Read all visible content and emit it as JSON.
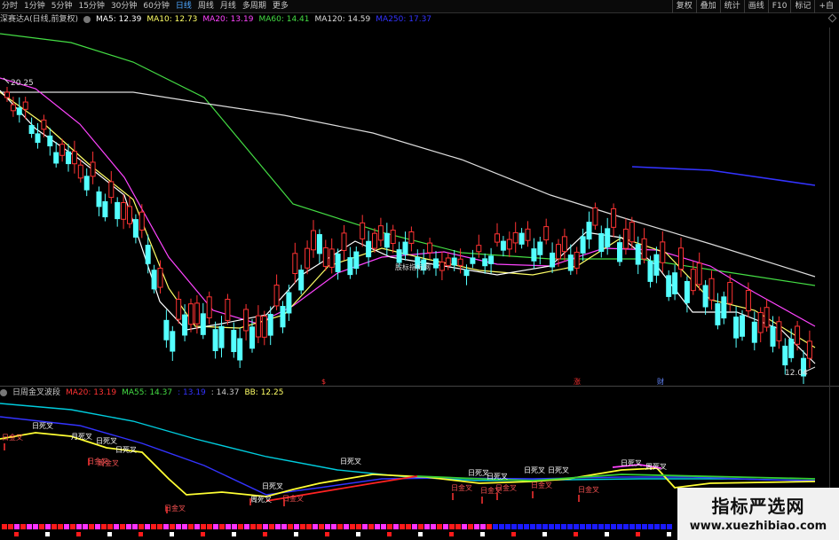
{
  "toolbar": {
    "tabs": [
      "分时",
      "1分钟",
      "5分钟",
      "15分钟",
      "30分钟",
      "60分钟",
      "日线",
      "周线",
      "月线",
      "多周期",
      "更多"
    ],
    "active_tab": 6,
    "tools": [
      "复权",
      "叠加",
      "统计",
      "画线",
      "F10",
      "标记",
      "+自"
    ]
  },
  "main_info": {
    "title": "深赛达A(日线,前复权)",
    "indicators": [
      {
        "text": "MA5: 12.39",
        "color": "#ffffff"
      },
      {
        "text": "MA10: 12.73",
        "color": "#ffff66"
      },
      {
        "text": "MA20: 13.19",
        "color": "#ff44ff"
      },
      {
        "text": "MA60: 14.41",
        "color": "#44dd44"
      },
      {
        "text": "MA120: 14.59",
        "color": "#dddddd"
      },
      {
        "text": "MA250: 17.37",
        "color": "#3333ff"
      }
    ],
    "high_label": "20.25",
    "low_label": "12.04",
    "center_watermark": "股标指标网",
    "event_markers": [
      {
        "text": "$",
        "color": "#ff3333"
      },
      {
        "text": "涨",
        "color": "#ff3333"
      },
      {
        "text": "财",
        "color": "#6688ff"
      }
    ]
  },
  "sub_info": {
    "title": "日周金叉波段",
    "indicators": [
      {
        "text": "MA20: 13.19",
        "color": "#ff3333"
      },
      {
        "text": "MA55: 14.37",
        "color": "#44dd44"
      },
      {
        "text": ": 13.19",
        "color": "#3333ff"
      },
      {
        "text": ": 14.37",
        "color": "#c8c8c8"
      },
      {
        "text": "BB: 12.25",
        "color": "#ffff66"
      }
    ],
    "signal_labels": {
      "day_dead": "日死叉",
      "month_dead": "月死叉",
      "day_gold": "日金叉",
      "week_gold": "周金叉",
      "week_dead": "周死叉"
    }
  },
  "colors": {
    "up": "#ff3333",
    "down": "#54ffff",
    "ma5": "#ffffff",
    "ma10": "#ffff66",
    "ma20": "#ff44ff",
    "ma60": "#44dd44",
    "ma120": "#dddddd",
    "ma250": "#3333ff"
  },
  "watermark": {
    "line1": "指标严选网",
    "line2": "www.xuezhibiao.com"
  }
}
